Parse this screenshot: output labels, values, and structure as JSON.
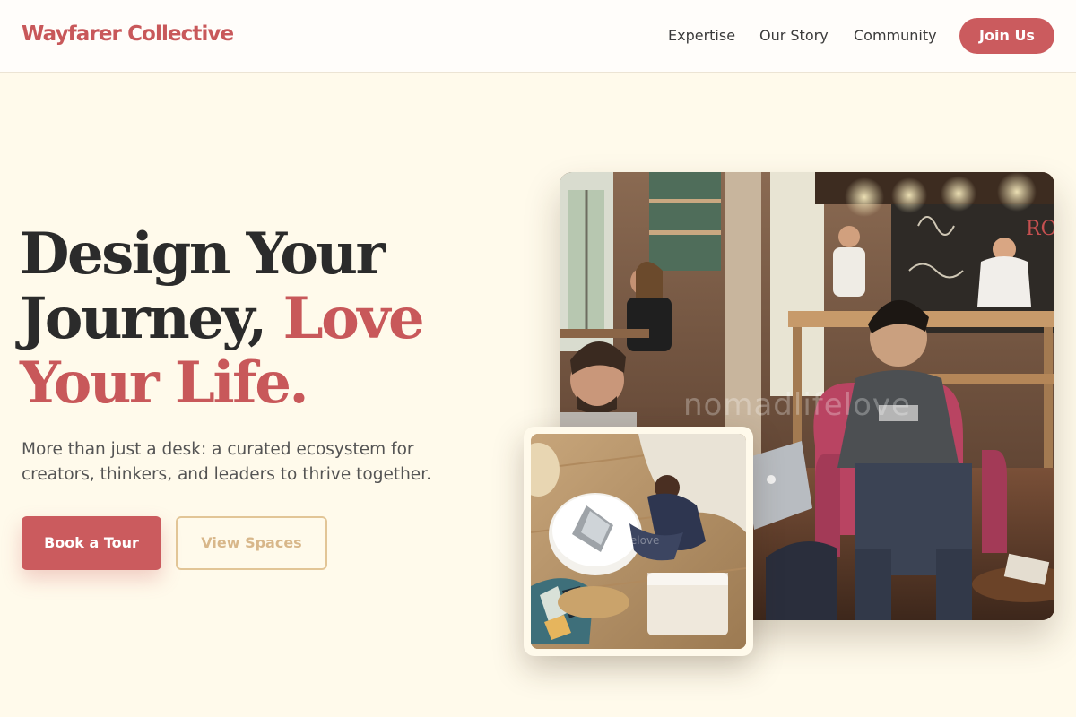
{
  "brand": {
    "name": "Wayfarer Collective",
    "accent_color": "#c8585a",
    "secondary_color": "#e2c596",
    "background_color": "#fffaeb"
  },
  "nav": {
    "links": [
      "Expertise",
      "Our Story",
      "Community"
    ],
    "cta_label": "Join Us"
  },
  "hero": {
    "headline_line1": "Design Your",
    "headline_line2a": "Journey, ",
    "headline_line2b": "Love",
    "headline_line3": "Your Life.",
    "subtitle": "More than just a desk: a curated ecosystem for creators, thinkers, and leaders to thrive together.",
    "primary_cta": "Book a Tour",
    "secondary_cta": "View Spaces"
  },
  "images": {
    "main_watermark": "nomadlifelove",
    "inset_watermark": "lifelove"
  }
}
